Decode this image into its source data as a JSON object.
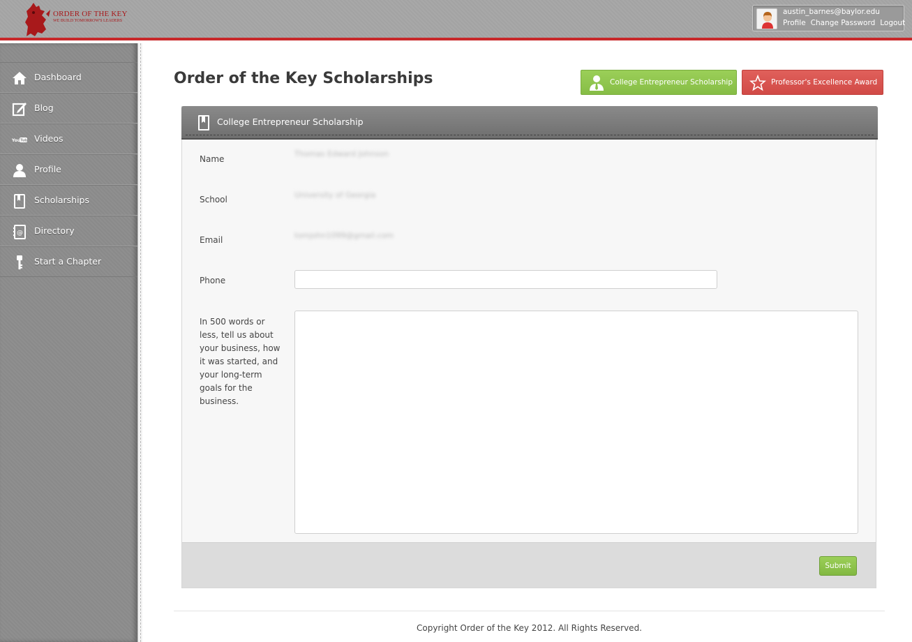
{
  "brand": {
    "name": "ORDER OF THE KEY",
    "tagline": "WE BUILD TOMORROW'S LEADERS"
  },
  "user": {
    "email": "austin_barnes@baylor.edu",
    "links": [
      "Profile",
      "Change Password",
      "Logout"
    ]
  },
  "sidebar": {
    "items": [
      {
        "label": "Dashboard",
        "icon": "home-icon"
      },
      {
        "label": "Blog",
        "icon": "edit-icon"
      },
      {
        "label": "Videos",
        "icon": "youtube-icon"
      },
      {
        "label": "Profile",
        "icon": "person-icon"
      },
      {
        "label": "Scholarships",
        "icon": "book-icon"
      },
      {
        "label": "Directory",
        "icon": "address-book-icon"
      },
      {
        "label": "Start a Chapter",
        "icon": "key-icon"
      }
    ]
  },
  "main": {
    "title": "Order of the Key Scholarships",
    "buttons": {
      "entrepreneur": "College Entrepreneur Scholarship",
      "professor": "Professor's Excellence Award"
    },
    "panel": {
      "title": "College Entrepreneur Scholarship",
      "fields": {
        "name_label": "Name",
        "name_value": "Thomas Edward Johnson",
        "school_label": "School",
        "school_value": "University of Georgia",
        "email_label": "Email",
        "email_value": "tomjohn1099@gmail.com",
        "phone_label": "Phone",
        "phone_value": "",
        "essay_label": "In 500 words or less, tell us about your business, how it was started, and your long-term goals for the business.",
        "essay_value": ""
      },
      "submit_label": "Submit"
    }
  },
  "footer": {
    "copyright": "Copyright Order of the Key 2012. All Rights Reserved."
  },
  "colors": {
    "accent_red": "#c8282a",
    "green": "#8bc34a",
    "red_button": "#d9534f"
  }
}
